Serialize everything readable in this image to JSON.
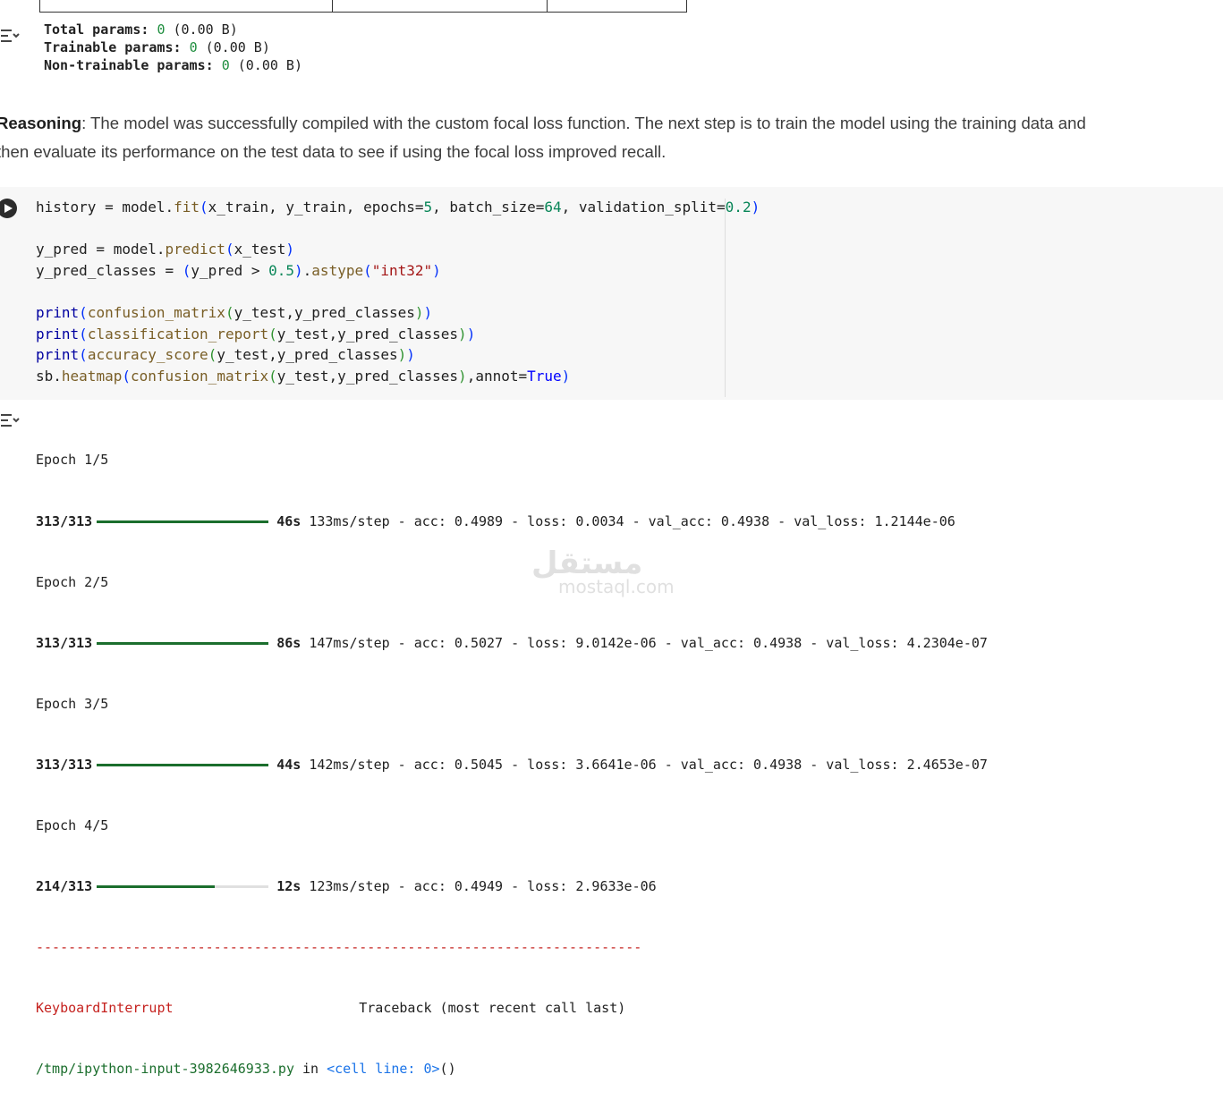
{
  "summary": {
    "total_label": "Total params:",
    "total_value": "0",
    "total_size": "(0.00 B)",
    "trainable_label": "Trainable params:",
    "trainable_value": "0",
    "trainable_size": "(0.00 B)",
    "nontrainable_label": "Non-trainable params:",
    "nontrainable_value": "0",
    "nontrainable_size": "(0.00 B)"
  },
  "reasoning": {
    "label": "Reasoning",
    "text": ": The model was successfully compiled with the custom focal loss function. The next step is to train the model using the training data and then evaluate its performance on the test data to see if using the focal loss improved recall."
  },
  "code_lines": [
    "history = model.fit(x_train, y_train, epochs=5, batch_size=64, validation_split=0.2)",
    "",
    "y_pred = model.predict(x_test)",
    "y_pred_classes = (y_pred > 0.5).astype(\"int32\")",
    "",
    "print(confusion_matrix(y_test,y_pred_classes))",
    "print(classification_report(y_test,y_pred_classes))",
    "print(accuracy_score(y_test,y_pred_classes))",
    "sb.heatmap(confusion_matrix(y_test,y_pred_classes),annot=True)"
  ],
  "output": {
    "epochs": [
      {
        "title": "Epoch 1/5",
        "steps": "313/313",
        "progress": 1.0,
        "time": "46s",
        "rest": " 133ms/step - acc: 0.4989 - loss: 0.0034 - val_acc: 0.4938 - val_loss: 1.2144e-06"
      },
      {
        "title": "Epoch 2/5",
        "steps": "313/313",
        "progress": 1.0,
        "time": "86s",
        "rest": " 147ms/step - acc: 0.5027 - loss: 9.0142e-06 - val_acc: 0.4938 - val_loss: 4.2304e-07"
      },
      {
        "title": "Epoch 3/5",
        "steps": "313/313",
        "progress": 1.0,
        "time": "44s",
        "rest": " 142ms/step - acc: 0.5045 - loss: 3.6641e-06 - val_acc: 0.4938 - val_loss: 2.4653e-07"
      },
      {
        "title": "Epoch 4/5",
        "steps": "214/313",
        "progress": 0.684,
        "time": "12s",
        "rest": " 123ms/step - acc: 0.4949 - loss: 2.9633e-06"
      }
    ],
    "dashes": "---------------------------------------------------------------------------",
    "error_name": "KeyboardInterrupt",
    "traceback_label": "Traceback (most recent call last)",
    "file_path": "/tmp/ipython-input-3982646933.py",
    "in_text": " in ",
    "cell_link": "<cell line: 0>",
    "call_parens": "()"
  },
  "watermark": {
    "arabic": "مستقل",
    "latin": "mostaql.com"
  },
  "colors": {
    "progress_fill": "#1b6e2d",
    "error": "#c5221f",
    "link": "#1a73e8",
    "number": "#1e8e3e"
  }
}
